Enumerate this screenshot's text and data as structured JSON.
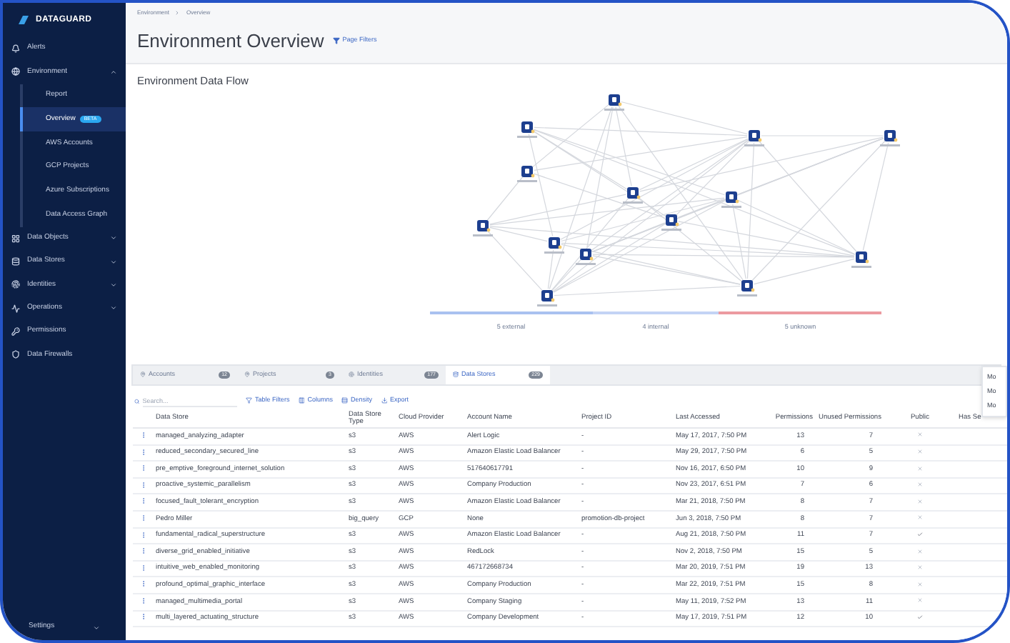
{
  "sidebar": {
    "logo": "DATAGUARD",
    "items": [
      {
        "label": "Alerts",
        "selected": false
      },
      {
        "label": "Environment",
        "selected": false,
        "expanded": true,
        "children": [
          {
            "label": "Report",
            "selected": false
          },
          {
            "label": "Overview",
            "badge": "BETA",
            "selected": true
          },
          {
            "label": "AWS Accounts",
            "selected": false
          },
          {
            "label": "GCP Projects",
            "selected": false
          },
          {
            "label": "Azure Subscriptions",
            "selected": false
          },
          {
            "label": "Data Access Graph",
            "selected": false
          }
        ]
      },
      {
        "label": "Data Objects",
        "selected": false,
        "expanded": false
      },
      {
        "label": "Data Stores",
        "selected": false,
        "expanded": false
      },
      {
        "label": "Identities",
        "selected": false,
        "expanded": false
      },
      {
        "label": "Operations",
        "selected": false,
        "expanded": false
      },
      {
        "label": "Permissions",
        "selected": false
      },
      {
        "label": "Data Firewalls",
        "selected": false
      }
    ],
    "footer": {
      "label": "Settings",
      "expanded": false
    }
  },
  "breadcrumb": [
    "Environment",
    "Overview"
  ],
  "title": "Environment Overview",
  "page_filters": "Page Filters",
  "section_title": "Environment Data Flow",
  "legend": [
    {
      "label": "5 external",
      "color": "#a9c1f0"
    },
    {
      "label": "4 internal",
      "color": "#c3d3f5"
    },
    {
      "label": "5 unknown",
      "color": "#ec9aa0"
    }
  ],
  "tabs": [
    {
      "label": "Accounts",
      "count": "12",
      "selected": false
    },
    {
      "label": "Projects",
      "count": "3",
      "selected": false
    },
    {
      "label": "Identities",
      "count": "177",
      "selected": false
    },
    {
      "label": "Data Stores",
      "count": "229",
      "selected": true
    }
  ],
  "toolbar": {
    "search_placeholder": "Search...",
    "buttons": [
      "Table Filters",
      "Columns",
      "Density",
      "Export"
    ]
  },
  "table": {
    "columns": [
      "Data Store",
      "Data Store Type",
      "Cloud Provider",
      "Account Name",
      "Project ID",
      "Last Accessed",
      "Permissions",
      "Unused Permissions",
      "Public",
      "Has Se"
    ],
    "rows": [
      {
        "cells": [
          "managed_analyzing_adapter",
          "s3",
          "AWS",
          "Alert Logic",
          "-",
          "May 17, 2017, 7:50 PM",
          "13",
          "7"
        ],
        "public": false
      },
      {
        "cells": [
          "reduced_secondary_secured_line",
          "s3",
          "AWS",
          "Amazon Elastic Load Balancer",
          "-",
          "May 29, 2017, 7:50 PM",
          "6",
          "5"
        ],
        "public": false
      },
      {
        "cells": [
          "pre_emptive_foreground_internet_solution",
          "s3",
          "AWS",
          "517640617791",
          "-",
          "Nov 16, 2017, 6:50 PM",
          "10",
          "9"
        ],
        "public": false
      },
      {
        "cells": [
          "proactive_systemic_parallelism",
          "s3",
          "AWS",
          "Company Production",
          "-",
          "Nov 23, 2017, 6:51 PM",
          "7",
          "6"
        ],
        "public": false
      },
      {
        "cells": [
          "focused_fault_tolerant_encryption",
          "s3",
          "AWS",
          "Amazon Elastic Load Balancer",
          "-",
          "Mar 21, 2018, 7:50 PM",
          "8",
          "7"
        ],
        "public": false
      },
      {
        "cells": [
          "Pedro Miller",
          "big_query",
          "GCP",
          "None",
          "promotion-db-project",
          "Jun 3, 2018, 7:50 PM",
          "8",
          "7"
        ],
        "public": false
      },
      {
        "cells": [
          "fundamental_radical_superstructure",
          "s3",
          "AWS",
          "Amazon Elastic Load Balancer",
          "-",
          "Aug 21, 2018, 7:50 PM",
          "11",
          "7"
        ],
        "public": true
      },
      {
        "cells": [
          "diverse_grid_enabled_initiative",
          "s3",
          "AWS",
          "RedLock",
          "-",
          "Nov 2, 2018, 7:50 PM",
          "15",
          "5"
        ],
        "public": false
      },
      {
        "cells": [
          "intuitive_web_enabled_monitoring",
          "s3",
          "AWS",
          "467172668734",
          "-",
          "Mar 20, 2019, 7:51 PM",
          "19",
          "13"
        ],
        "public": false
      },
      {
        "cells": [
          "profound_optimal_graphic_interface",
          "s3",
          "AWS",
          "Company Production",
          "-",
          "Mar 22, 2019, 7:51 PM",
          "15",
          "8"
        ],
        "public": false
      },
      {
        "cells": [
          "managed_multimedia_portal",
          "s3",
          "AWS",
          "Company Staging",
          "-",
          "May 11, 2019, 7:52 PM",
          "13",
          "11"
        ],
        "public": false
      },
      {
        "cells": [
          "multi_layered_actuating_structure",
          "s3",
          "AWS",
          "Company Development",
          "-",
          "May 17, 2019, 7:51 PM",
          "12",
          "10"
        ],
        "public": true
      }
    ]
  },
  "menu": [
    "Mo",
    "Mo",
    "Mo"
  ]
}
